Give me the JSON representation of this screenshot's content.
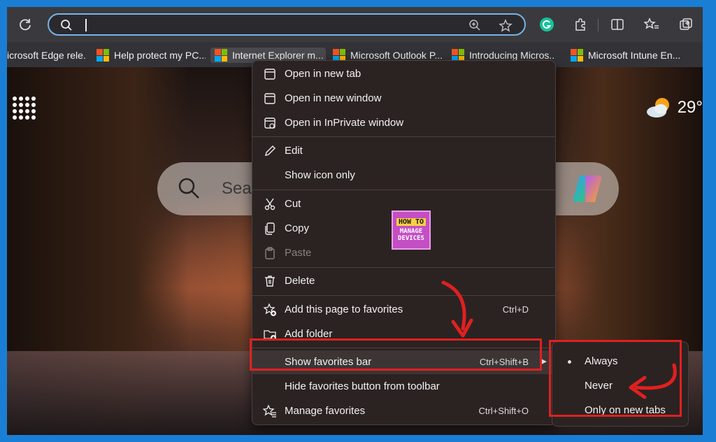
{
  "toolbar": {
    "address_value": "",
    "icons": [
      "refresh-icon",
      "search-icon",
      "zoom-icon",
      "star-icon",
      "grammarly-icon",
      "extensions-icon",
      "split-screen-icon",
      "favorites-icon",
      "collections-icon"
    ]
  },
  "favorites_bar": [
    {
      "label": "icrosoft Edge rele...",
      "has_logo": false
    },
    {
      "label": "Help protect my PC...",
      "has_logo": true
    },
    {
      "label": "Internet Explorer m...",
      "has_logo": true
    },
    {
      "label": "Microsoft Outlook P...",
      "has_logo": true
    },
    {
      "label": "Introducing Micros...",
      "has_logo": true
    },
    {
      "label": "Microsoft Intune En...",
      "has_logo": true
    }
  ],
  "newtab": {
    "search_placeholder": "Sea",
    "temperature": "29°"
  },
  "logo": {
    "line1": "HOW TO",
    "line2": "MANAGE DEVICES"
  },
  "menu": {
    "items": [
      {
        "label": "Open in new tab",
        "icon": "new-tab-icon"
      },
      {
        "label": "Open in new window",
        "icon": "window-icon"
      },
      {
        "label": "Open in InPrivate window",
        "icon": "inprivate-icon"
      },
      {
        "label": "Edit",
        "icon": "pencil-icon"
      },
      {
        "label": "Show icon only",
        "icon": ""
      },
      {
        "label": "Cut",
        "icon": "scissors-icon"
      },
      {
        "label": "Copy",
        "icon": "copy-icon"
      },
      {
        "label": "Paste",
        "icon": "paste-icon",
        "disabled": true
      },
      {
        "label": "Delete",
        "icon": "trash-icon"
      },
      {
        "label": "Add this page to favorites",
        "icon": "star-add-icon",
        "shortcut": "Ctrl+D"
      },
      {
        "label": "Add folder",
        "icon": "folder-add-icon"
      },
      {
        "label": "Show favorites bar",
        "icon": "",
        "shortcut": "Ctrl+Shift+B",
        "submenu": true
      },
      {
        "label": "Hide favorites button from toolbar",
        "icon": ""
      },
      {
        "label": "Manage favorites",
        "icon": "manage-favorites-icon",
        "shortcut": "Ctrl+Shift+O"
      }
    ]
  },
  "submenu": {
    "items": [
      {
        "label": "Always",
        "selected": true
      },
      {
        "label": "Never",
        "selected": false
      },
      {
        "label": "Only on new tabs",
        "selected": false
      }
    ]
  },
  "colors": {
    "accent_focus": "#79b3e8",
    "annotation": "#e02020",
    "border": "#1a7fd4"
  }
}
